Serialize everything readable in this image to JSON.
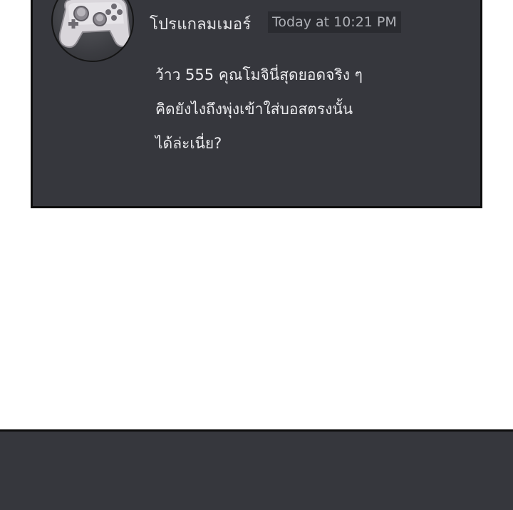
{
  "message": {
    "username": "โปรแกลมเมอร์",
    "timestamp": "Today at 10:21 PM",
    "lines": [
      "ว้าว 555 คุณโมจินี่สุดยอดจริง ๆ",
      "คิดยังไงถึงพุ่งเข้าใส่บอสตรงนั้น",
      "ได้ล่ะเนี่ย?"
    ],
    "avatar_icon": "game-controller-icon"
  },
  "colors": {
    "panel_background": "#36373d",
    "timestamp_background": "#2a2b30",
    "border": "#0d0d0d"
  }
}
